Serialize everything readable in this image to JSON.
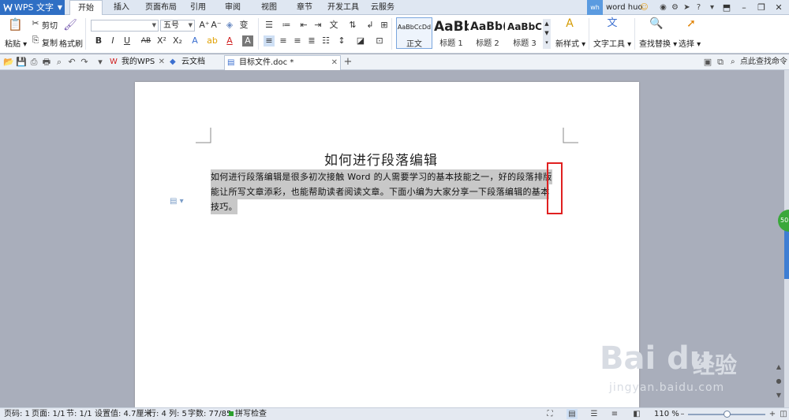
{
  "app": {
    "name": "WPS 文字"
  },
  "menu_tabs": [
    "开始",
    "插入",
    "页面布局",
    "引用",
    "审阅",
    "视图",
    "章节",
    "开发工具",
    "云服务"
  ],
  "user": {
    "badge": "wh",
    "name": "word huo"
  },
  "ribbon": {
    "paste": "粘贴",
    "cut": "剪切",
    "copy": "复制",
    "format_painter": "格式刷",
    "font_name": "",
    "font_size": "五号",
    "styles": [
      {
        "sample": "AaBbCcDd",
        "name": "正文"
      },
      {
        "sample": "AaBb",
        "name": "标题 1"
      },
      {
        "sample": "AaBb(",
        "name": "标题 2"
      },
      {
        "sample": "AaBbC",
        "name": "标题 3"
      }
    ],
    "new_style": "新样式",
    "text_tools": "文字工具",
    "find_replace": "查找替换",
    "select": "选择"
  },
  "doc_tabs": [
    {
      "label": "我的WPS"
    },
    {
      "label": "云文档"
    },
    {
      "label": "目标文件.doc *"
    }
  ],
  "command_search": "点此查找命令",
  "document": {
    "title": "如何进行段落编辑",
    "lines": [
      "如何进行段落编辑是很多初次接触 Word 的人需要学习的基本技能之一，好的段落排版",
      "能让所写文章添彩，也能帮助读者阅读文章。下面小编为大家分享一下段落编辑的基本",
      "技巧。"
    ]
  },
  "side_badge": "50",
  "status": {
    "page_code": "页码: 1",
    "pages": "页面: 1/1",
    "section": "节: 1/1",
    "position": "设置值: 4.7厘米",
    "row": "行: 4",
    "col": "列: 5",
    "word_count": "字数: 77/85",
    "spell_check": "拼写检查",
    "zoom": "110 %"
  },
  "watermark": {
    "logo": "Bai du",
    "cn": "经验",
    "url": "jingyan.baidu.com"
  },
  "colors": {
    "accent": "#2f6fc4",
    "highlight_box": "#e02020",
    "selection": "#c8c8c8"
  }
}
